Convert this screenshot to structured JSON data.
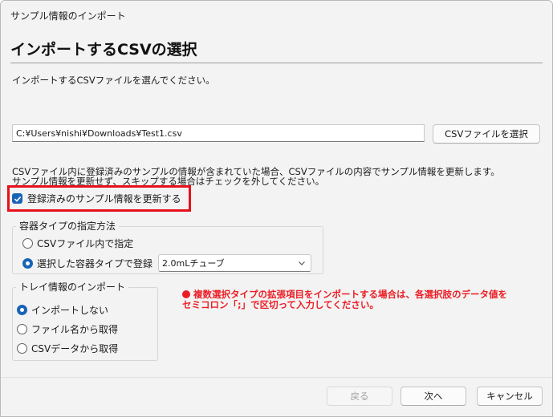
{
  "window": {
    "title": "サンプル情報のインポート"
  },
  "page": {
    "heading": "インポートするCSVの選択",
    "instruction": "インポートするCSVファイルを選んでください。"
  },
  "file": {
    "path": "C:¥Users¥nishi¥Downloads¥Test1.csv",
    "select_button": "CSVファイルを選択"
  },
  "note": {
    "line1": "CSVファイル内に登録済みのサンプルの情報が含まれていた場合、CSVファイルの内容でサンプル情報を更新します。",
    "line2": "サンプル情報を更新せず、スキップする場合はチェックを外してください。"
  },
  "update_checkbox": {
    "label": "登録済みのサンプル情報を更新する",
    "checked": true
  },
  "container_group": {
    "label": "容器タイプの指定方法",
    "options": [
      {
        "label": "CSVファイル内で指定",
        "selected": false
      },
      {
        "label": "選択した容器タイプで登録",
        "selected": true
      }
    ],
    "selected_type": "2.0mLチューブ"
  },
  "tray_group": {
    "label": "トレイ情報のインポート",
    "options": [
      {
        "label": "インポートしない",
        "selected": true
      },
      {
        "label": "ファイル名から取得",
        "selected": false
      },
      {
        "label": "CSVデータから取得",
        "selected": false
      }
    ]
  },
  "warning": {
    "line1": "複数選択タイプの拡張項目をインポートする場合は、各選択肢のデータ値を",
    "line2": "セミコロン「;」で区切って入力してください。",
    "color": "#ec1c24"
  },
  "buttons": {
    "back": "戻る",
    "next": "次へ",
    "cancel": "キャンセル"
  },
  "colors": {
    "accent": "#1863b7",
    "highlight": "#e8101a"
  }
}
